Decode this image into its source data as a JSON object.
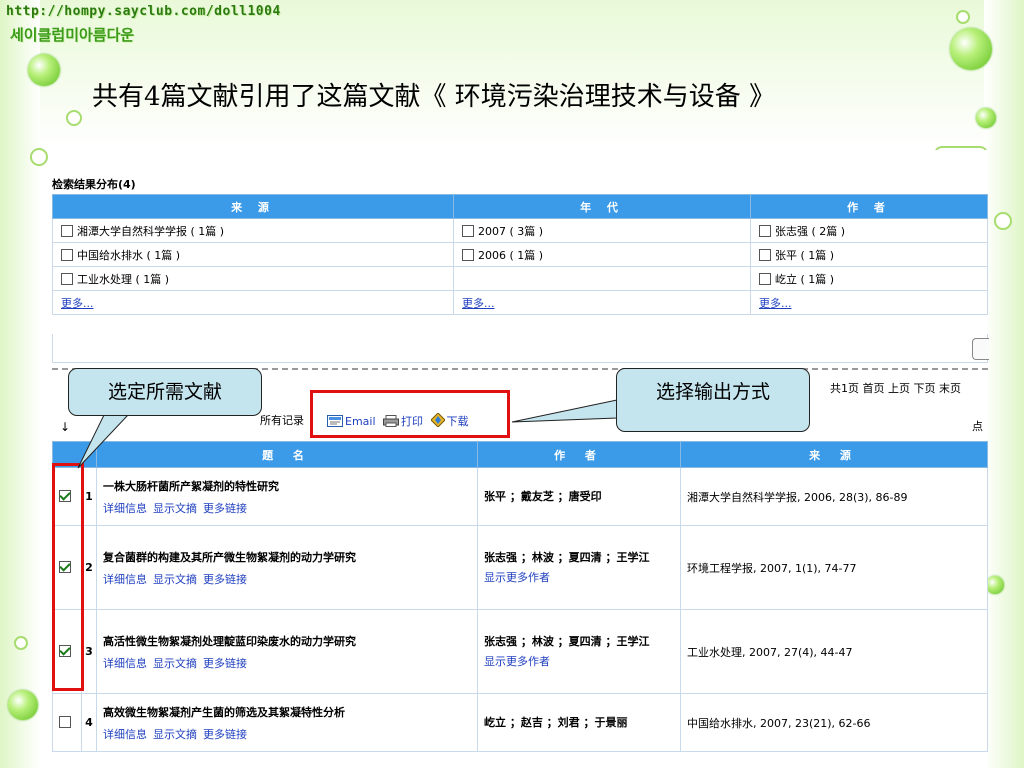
{
  "site": {
    "url": "http://hompy.sayclub.com/doll1004",
    "name": "세이클럽미아름다운"
  },
  "page_title": "共有4篇文献引用了这篇文献《 环境污染治理技术与设备 》",
  "distribution": {
    "heading": "检索结果分布(4)",
    "columns": [
      "来 源",
      "年 代",
      "作 者"
    ],
    "sources": [
      "湘潭大学自然科学学报 ( 1篇 )",
      "中国给水排水 ( 1篇 )",
      "工业水处理 ( 1篇 )"
    ],
    "years": [
      "2007 ( 3篇 )",
      "2006 ( 1篇 )"
    ],
    "authors": [
      "张志强 ( 2篇 )",
      "张平 ( 1篇 )",
      "屹立 ( 1篇 )"
    ],
    "more": "更多..."
  },
  "pager": "共1页 首页 上页 下页 末页",
  "click_hint": "点",
  "all_records": "所有记录",
  "output": {
    "email": "Email",
    "print": "打印",
    "download": "下载"
  },
  "results": {
    "columns": [
      "题 名",
      "作 者",
      "来 源"
    ],
    "link_labels": [
      "详细信息",
      "显示文摘",
      "更多链接"
    ],
    "more_authors": "显示更多作者",
    "rows": [
      {
        "no": "1",
        "checked": true,
        "title": "一株大肠杆菌所产絮凝剂的特性研究",
        "authors": "张平 ；戴友芝 ；唐受印",
        "more_authors": false,
        "source": "湘潭大学自然科学学报, 2006, 28(3), 86-89"
      },
      {
        "no": "2",
        "checked": true,
        "title": "复合菌群的构建及其所产微生物絮凝剂的动力学研究",
        "authors": "张志强 ；林波 ；夏四清 ；王学江",
        "more_authors": true,
        "source": "环境工程学报, 2007, 1(1), 74-77"
      },
      {
        "no": "3",
        "checked": true,
        "title": "高活性微生物絮凝剂处理靛蓝印染废水的动力学研究",
        "authors": "张志强 ；林波 ；夏四清 ；王学江",
        "more_authors": true,
        "source": "工业水处理, 2007, 27(4), 44-47"
      },
      {
        "no": "4",
        "checked": false,
        "title": "高效微生物絮凝剂产生菌的筛选及其絮凝特性分析",
        "authors": "屹立 ；赵吉 ；刘君 ；于景丽",
        "more_authors": false,
        "source": "中国给水排水, 2007, 23(21), 62-66"
      }
    ]
  },
  "callouts": {
    "select": "选定所需文献",
    "output": "选择输出方式"
  },
  "colors": {
    "header_blue": "#3c9be8",
    "highlight_red": "#e01010",
    "callout_fill": "#c5e5ee",
    "link_blue": "#1f3fbf"
  }
}
